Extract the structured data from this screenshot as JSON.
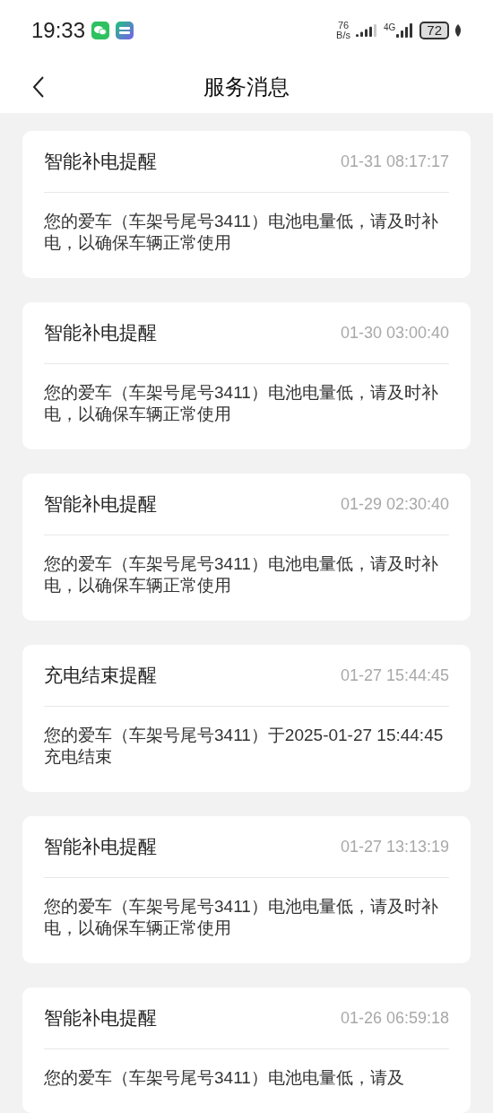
{
  "status_bar": {
    "time": "19:33",
    "net_speed_value": "76",
    "net_speed_unit": "B/s",
    "network_type": "4G",
    "battery": "72"
  },
  "header": {
    "title": "服务消息"
  },
  "messages": [
    {
      "title": "智能补电提醒",
      "time": "01-31 08:17:17",
      "body": "您的爱车（车架号尾号3411）电池电量低，请及时补电，以确保车辆正常使用"
    },
    {
      "title": "智能补电提醒",
      "time": "01-30 03:00:40",
      "body": "您的爱车（车架号尾号3411）电池电量低，请及时补电，以确保车辆正常使用"
    },
    {
      "title": "智能补电提醒",
      "time": "01-29 02:30:40",
      "body": "您的爱车（车架号尾号3411）电池电量低，请及时补电，以确保车辆正常使用"
    },
    {
      "title": "充电结束提醒",
      "time": "01-27 15:44:45",
      "body": "您的爱车（车架号尾号3411）于2025-01-27 15:44:45充电结束"
    },
    {
      "title": "智能补电提醒",
      "time": "01-27 13:13:19",
      "body": "您的爱车（车架号尾号3411）电池电量低，请及时补电，以确保车辆正常使用"
    },
    {
      "title": "智能补电提醒",
      "time": "01-26 06:59:18",
      "body": "您的爱车（车架号尾号3411）电池电量低，请及"
    }
  ]
}
